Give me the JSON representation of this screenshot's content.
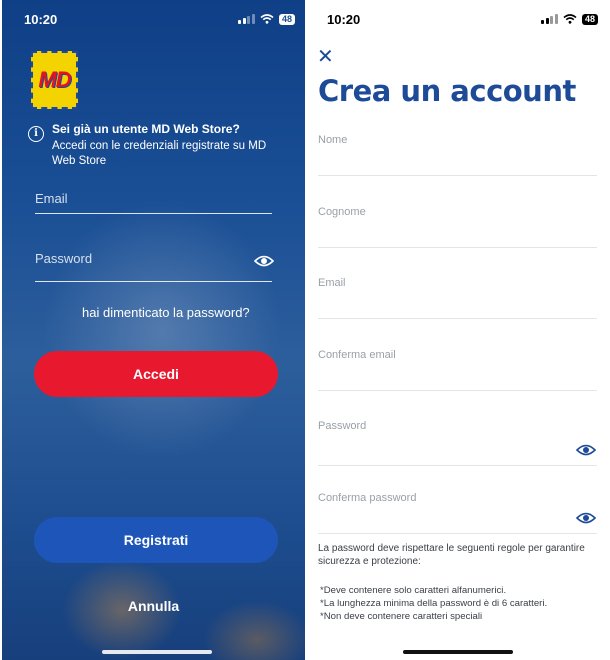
{
  "left_screen": {
    "status": {
      "time": "10:20",
      "battery": "48"
    },
    "logo_text": "MD",
    "info": {
      "title": "Sei già un utente MD Web Store?",
      "subtitle": "Accedi con le credenziali registrate su MD Web Store"
    },
    "email": {
      "placeholder": "Email",
      "value": ""
    },
    "password": {
      "placeholder": "Password",
      "value": ""
    },
    "forgot_label": "hai dimenticato la password?",
    "login_label": "Accedi",
    "register_label": "Registrati",
    "cancel_label": "Annulla"
  },
  "right_screen": {
    "status": {
      "time": "10:20",
      "battery": "48"
    },
    "title": "Crea un account",
    "fields": {
      "nome": "Nome",
      "cognome": "Cognome",
      "email": "Email",
      "conferma_email": "Conferma email",
      "password": "Password",
      "conferma_password": "Conferma password"
    },
    "password_rules_intro": "La password deve rispettare le seguenti regole per garantire sicurezza e protezione:",
    "password_rules": [
      "*Deve contenere solo caratteri alfanumerici.",
      "*La lunghezza minima della password è di 6 caratteri.",
      "*Non deve contenere caratteri speciali"
    ]
  },
  "colors": {
    "brand_blue": "#1e4b98",
    "login_red": "#e8192e",
    "register_blue": "#1d56b8",
    "logo_yellow": "#f3d400"
  },
  "icons": [
    "info-icon",
    "eye-icon",
    "close-icon",
    "signal-icon",
    "wifi-icon",
    "battery-icon"
  ]
}
